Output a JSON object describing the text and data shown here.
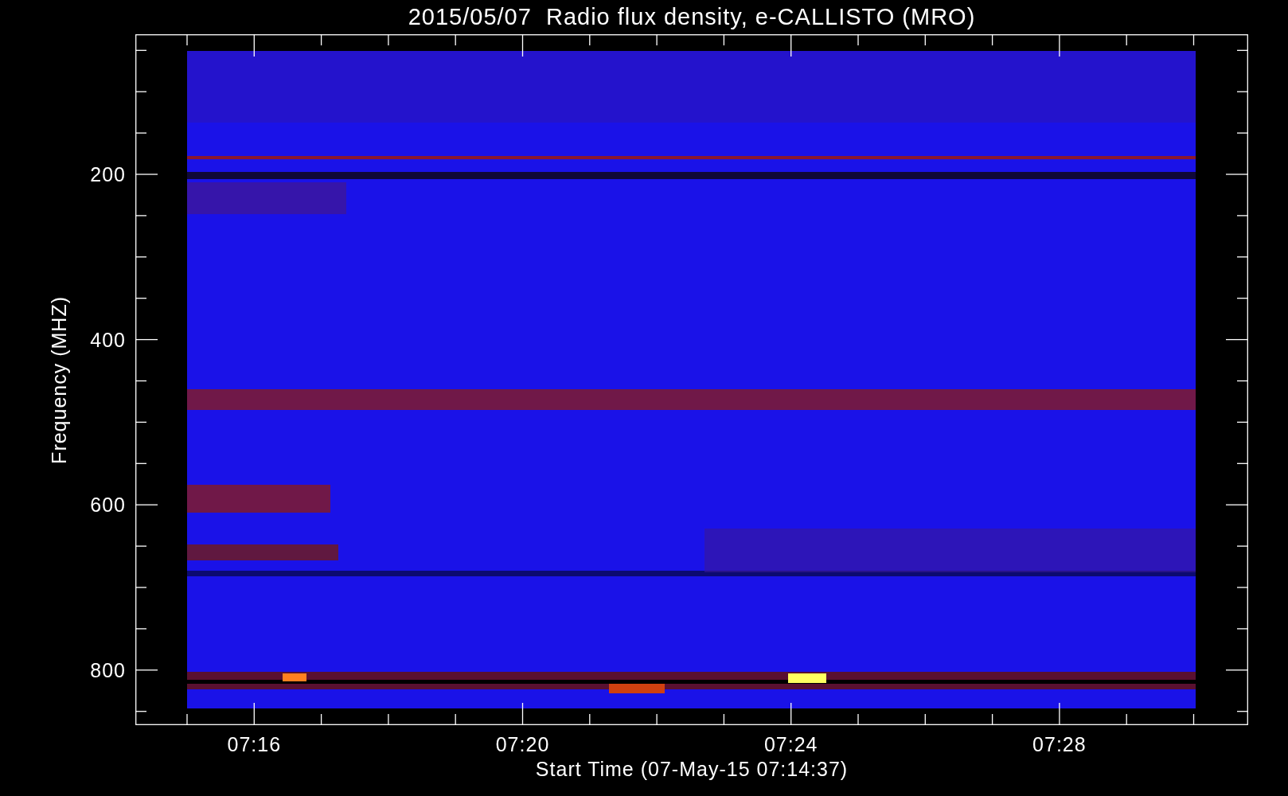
{
  "title": "2015/05/07  Radio flux density, e-CALLISTO (MRO)",
  "y_axis": {
    "label": "Frequency (MHZ)",
    "tick_labels": [
      "200",
      "400",
      "600",
      "800"
    ]
  },
  "x_axis": {
    "label": "Start Time (07-May-15 07:14:37)",
    "tick_labels": [
      "07:16",
      "07:20",
      "07:24",
      "07:28"
    ]
  }
}
